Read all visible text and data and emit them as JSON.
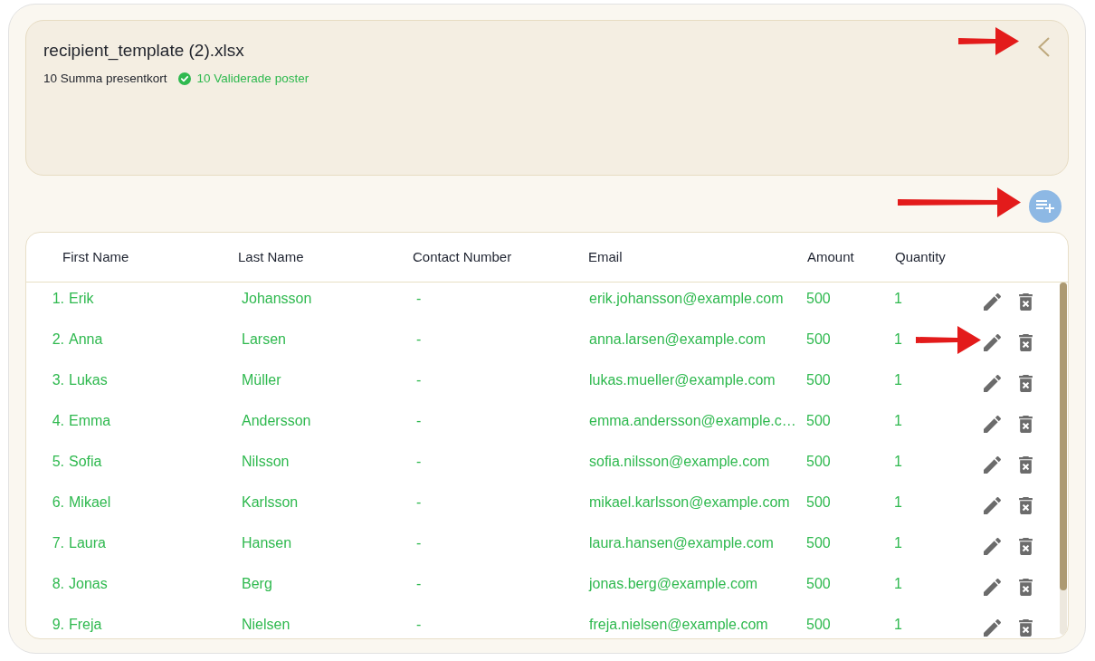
{
  "file_panel": {
    "title": "recipient_template (2).xlsx",
    "total": "10 Summa presentkort",
    "validated": "10 Validerade poster"
  },
  "table": {
    "columns": [
      "First Name",
      "Last Name",
      "Contact Number",
      "Email",
      "Amount",
      "Quantity"
    ],
    "rows": [
      {
        "number": "1.",
        "first_name": "Erik",
        "last_name": "Johansson",
        "contact_number": "-",
        "email": "erik.johansson@example.com",
        "amount": "500",
        "quantity": "1",
        "valid": true
      },
      {
        "number": "2.",
        "first_name": "Anna",
        "last_name": "Larsen",
        "contact_number": "-",
        "email": "anna.larsen@example.com",
        "amount": "500",
        "quantity": "1",
        "valid": true
      },
      {
        "number": "3.",
        "first_name": "Lukas",
        "last_name": "Müller",
        "contact_number": "-",
        "email": "lukas.mueller@example.com",
        "amount": "500",
        "quantity": "1",
        "valid": true
      },
      {
        "number": "4.",
        "first_name": "Emma",
        "last_name": "Andersson",
        "contact_number": "-",
        "email": "emma.andersson@example.c…",
        "amount": "500",
        "quantity": "1",
        "valid": true
      },
      {
        "number": "5.",
        "first_name": "Sofia",
        "last_name": "Nilsson",
        "contact_number": "-",
        "email": "sofia.nilsson@example.com",
        "amount": "500",
        "quantity": "1",
        "valid": true
      },
      {
        "number": "6.",
        "first_name": "Mikael",
        "last_name": "Karlsson",
        "contact_number": "-",
        "email": "mikael.karlsson@example.com",
        "amount": "500",
        "quantity": "1",
        "valid": true
      },
      {
        "number": "7.",
        "first_name": "Laura",
        "last_name": "Hansen",
        "contact_number": "-",
        "email": "laura.hansen@example.com",
        "amount": "500",
        "quantity": "1",
        "valid": true
      },
      {
        "number": "8.",
        "first_name": "Jonas",
        "last_name": "Berg",
        "contact_number": "-",
        "email": "jonas.berg@example.com",
        "amount": "500",
        "quantity": "1",
        "valid": true
      },
      {
        "number": "9.",
        "first_name": "Freja",
        "last_name": "Nielsen",
        "contact_number": "-",
        "email": "freja.nielsen@example.com",
        "amount": "500",
        "quantity": "1",
        "valid": true
      }
    ]
  }
}
